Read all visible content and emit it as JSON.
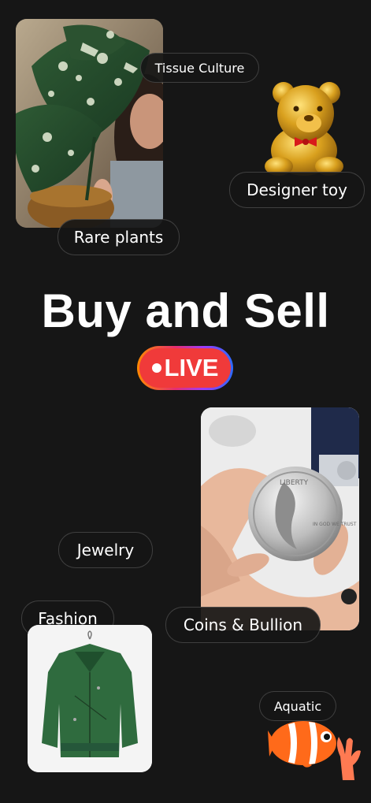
{
  "headline": "Buy and Sell",
  "live_badge": "LIVE",
  "categories": {
    "tissue_culture": "Tissue Culture",
    "designer_toy": "Designer toy",
    "rare_plants": "Rare plants",
    "jewelry": "Jewelry",
    "fashion": "Fashion",
    "coins_bullion": "Coins & Bullion",
    "aquatic": "Aquatic"
  },
  "coin": {
    "top_text": "LIBERTY",
    "motto": "IN GOD WE TRUST"
  },
  "colors": {
    "background": "#161616",
    "live_red": "#f03a3a",
    "chip_bg": "#161616"
  }
}
